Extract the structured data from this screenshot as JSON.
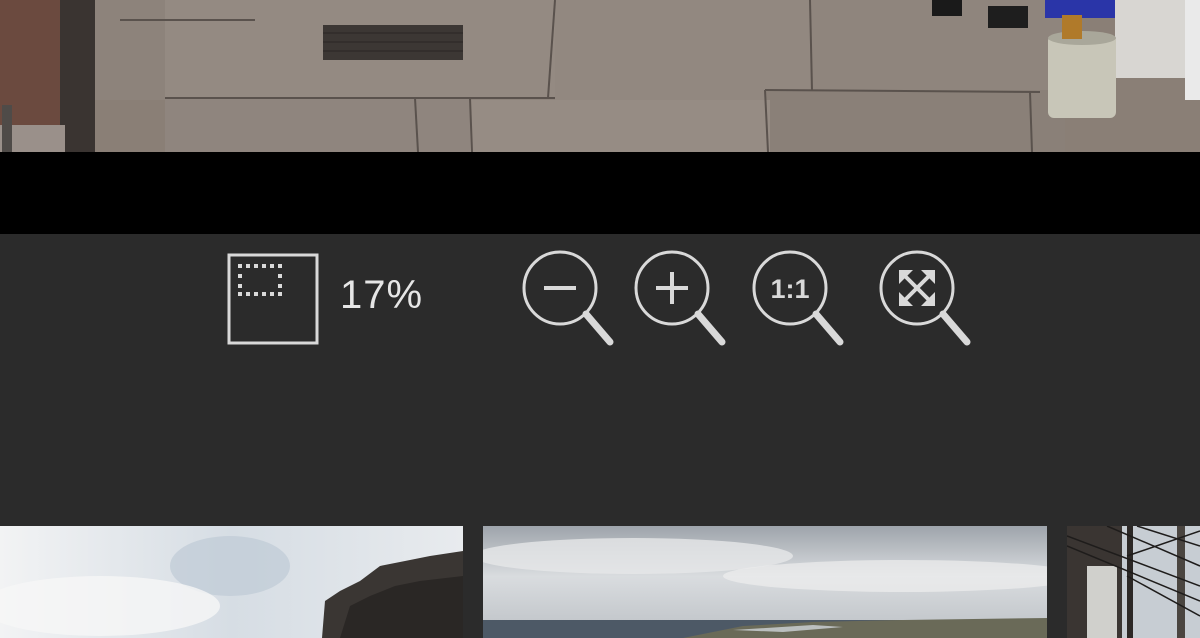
{
  "viewer": {
    "zoom_level": "17%"
  },
  "toolbar": {
    "buttons": [
      {
        "icon": "fit-to-window-icon"
      },
      {
        "icon": "zoom-out-icon"
      },
      {
        "icon": "zoom-in-icon"
      },
      {
        "icon": "actual-size-icon",
        "label": "1:1"
      },
      {
        "icon": "fit-screen-icon"
      }
    ]
  },
  "filmstrip": {
    "thumbnails": [
      {
        "subject": "cliff-and-cloudy-sky"
      },
      {
        "subject": "sea-horizon-overcast"
      },
      {
        "subject": "power-lines-street"
      }
    ]
  },
  "colors": {
    "toolbar_bg": "#2b2b2b",
    "letterbox": "#000000",
    "icon_stroke": "#d9d9d9"
  }
}
